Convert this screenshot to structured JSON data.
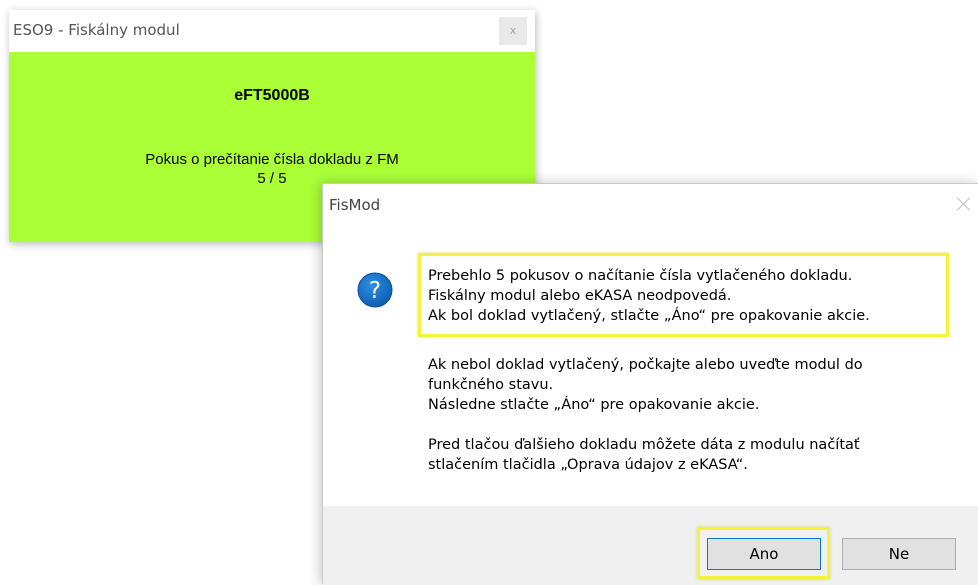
{
  "eso_window": {
    "title": "ESO9 - Fiskálny modul",
    "close_glyph": "x",
    "device": "eFT5000B",
    "status_line1": "Pokus o prečítanie čísla dokladu z FM",
    "status_line2": "5 / 5",
    "background_color": "#aaff37"
  },
  "dialog": {
    "title": "FisMod",
    "icon": "question-icon",
    "highlighted_lines": [
      "Prebehlo 5 pokusov o načítanie čísla vytlačeného dokladu.",
      "Fiskálny modul alebo eKASA neodpovedá.",
      "Ak bol doklad vytlačený, stlačte „Áno“ pre opakovanie akcie."
    ],
    "lines2": [
      "Ak nebol doklad vytlačený, počkajte alebo uveďte modul do",
      "funkčného stavu.",
      "Následne stlačte „Áno“ pre opakovanie akcie."
    ],
    "lines3": [
      "Pred tlačou ďalšieho dokladu môžete dáta z modulu načítať",
      "stlačením tlačidla „Oprava údajov z eKASA“."
    ],
    "buttons": {
      "yes": "Ano",
      "no": "Ne"
    },
    "highlight_color": "#f3f33c"
  }
}
